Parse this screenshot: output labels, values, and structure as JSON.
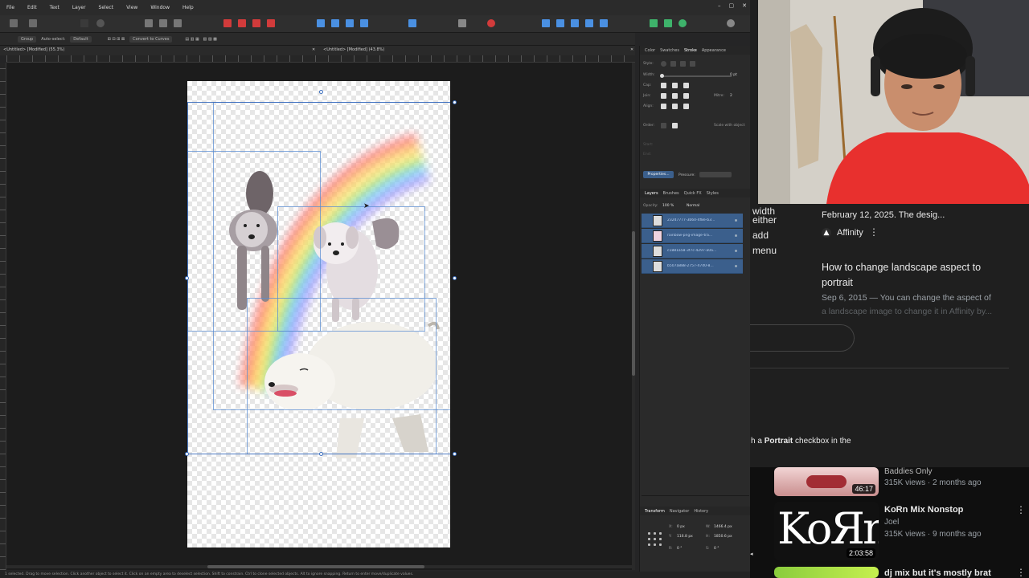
{
  "app": {
    "menu": [
      "File",
      "Edit",
      "Text",
      "Layer",
      "Select",
      "View",
      "Window",
      "Help"
    ],
    "window_controls": [
      "–",
      "▢",
      "✕"
    ],
    "context": {
      "group_label": "Group",
      "auto_select_label": "Auto-select:",
      "auto_select_value": "Default",
      "convert_label": "Convert to Curves"
    },
    "tabs": [
      {
        "label": "<Untitled> [Modified] (55.3%)",
        "close": "✕"
      },
      {
        "label": "<Untitled> [Modified] (43.8%)",
        "close": "✕"
      }
    ],
    "status": "1 selected. Drag to move selection. Click another object to select it. Click on an empty area to deselect selection. Shift to constrain. Ctrl to clone selected objects. Alt to ignore snapping. Return to enter move/duplicate values."
  },
  "stroke_panel": {
    "tabs": [
      "Color",
      "Swatches",
      "Stroke",
      "Appearance"
    ],
    "active_tab": "Stroke",
    "style_label": "Style:",
    "width_label": "Width:",
    "width_value": "0 pt",
    "cap_label": "Cap:",
    "join_label": "Join:",
    "mitre_label": "Mitre:",
    "mitre_value": "2",
    "align_label": "Align:",
    "order_label": "Order:",
    "scale_label": "Scale with object",
    "start_label": "Start:",
    "end_label": "End:",
    "properties_button": "Properties...",
    "pressure_label": "Pressure:"
  },
  "layers_panel": {
    "tabs": [
      "Layers",
      "Brushes",
      "Quick FX",
      "Styles"
    ],
    "active_tab": "Layers",
    "opacity_label": "Opacity:",
    "opacity_value": "100 %",
    "blend_mode": "Normal",
    "layers": [
      {
        "name": "23247777-3b60-4f8e-b3..."
      },
      {
        "name": "rainbow-png-image-tra..."
      },
      {
        "name": "c1881a58-3f7c-4297-a0a..."
      },
      {
        "name": "b507a888-2757-47d0-8..."
      }
    ]
  },
  "transform_panel": {
    "tabs": [
      "Transform",
      "Navigator",
      "History"
    ],
    "active_tab": "Transform",
    "x_label": "X:",
    "x_value": "0 px",
    "y_label": "Y:",
    "y_value": "116.8 px",
    "w_label": "W:",
    "w_value": "1466.4 px",
    "h_label": "H:",
    "h_value": "1850.6 px",
    "r_label": "R:",
    "r_value": "0 °",
    "s_label": "S:",
    "s_value": "0 °"
  },
  "browser": {
    "snippet_left": [
      "width",
      "either",
      "add",
      "menu"
    ],
    "result1_date": "February 12, 2025. The desig...",
    "result1_source": "Affinity",
    "result2_title": "How to change landscape aspect to portrait",
    "result2_date": "Sep 6, 2015 — You can change the aspect of",
    "result2_more": "a landscape image to change it in Affinity by...",
    "portrait_prefix": "h a ",
    "portrait_bold": "Portrait",
    "portrait_suffix": " checkbox in the",
    "videos": [
      {
        "title": "Baddies Only",
        "meta": "315K views · 2 months ago",
        "duration": "46:17"
      },
      {
        "title": "KoRn Mix Nonstop",
        "channel": "Joel",
        "meta": "315K views · 9 months ago",
        "duration": "2:03:58",
        "thumb_text": "KoЯn"
      },
      {
        "title": "dj mix but it's mostly brat"
      }
    ]
  },
  "colors": {
    "selection_blue": "#3b5f8c",
    "accent_blue": "#4a90e2",
    "shirt_red": "#e8302e"
  }
}
